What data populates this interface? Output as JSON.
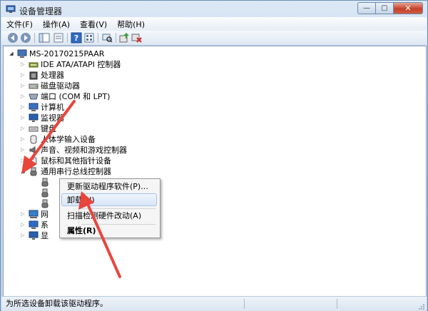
{
  "window": {
    "title": "设备管理器",
    "buttons": {
      "minimize": "—",
      "maximize": "▢",
      "close": "✕"
    }
  },
  "menubar": [
    {
      "label": "文件(F)"
    },
    {
      "label": "操作(A)"
    },
    {
      "label": "查看(V)"
    },
    {
      "label": "帮助(H)"
    }
  ],
  "toolbar": [
    {
      "icon": "back-arrow-icon"
    },
    {
      "icon": "forward-arrow-icon"
    },
    {
      "icon": "show-hide-tree-icon"
    },
    {
      "icon": "properties-icon"
    },
    {
      "icon": "help-icon"
    },
    {
      "icon": "view-list-icon"
    },
    {
      "icon": "scan-hardware-icon"
    },
    {
      "icon": "update-driver-icon"
    },
    {
      "icon": "uninstall-icon"
    }
  ],
  "tree": {
    "root": "MS-20170215PAAR",
    "categories": [
      {
        "label": "IDE ATA/ATAPI 控制器",
        "icon": "ide-controller-icon"
      },
      {
        "label": "处理器",
        "icon": "processor-icon"
      },
      {
        "label": "磁盘驱动器",
        "icon": "disk-drive-icon"
      },
      {
        "label": "端口 (COM 和 LPT)",
        "icon": "port-icon"
      },
      {
        "label": "计算机",
        "icon": "computer-icon"
      },
      {
        "label": "监视器",
        "icon": "monitor-icon"
      },
      {
        "label": "键盘",
        "icon": "keyboard-icon"
      },
      {
        "label": "人体学输入设备",
        "icon": "hid-icon"
      },
      {
        "label": "声音、视频和游戏控制器",
        "icon": "sound-icon"
      },
      {
        "label": "鼠标和其他指针设备",
        "icon": "mouse-icon"
      },
      {
        "label": "通用串行总线控制器",
        "icon": "usb-icon"
      },
      {
        "label": "网",
        "icon": "network-icon"
      },
      {
        "label": "系",
        "icon": "system-icon"
      },
      {
        "label": "显",
        "icon": "display-icon"
      }
    ],
    "usb_children_count_visible": 3
  },
  "context_menu": {
    "items": [
      {
        "label": "更新驱动程序软件(P)..."
      },
      {
        "label": "卸载(U)"
      },
      {
        "label": "扫描检测硬件改动(A)"
      },
      {
        "label": "属性(R)"
      }
    ]
  },
  "statusbar": {
    "text": "为所选设备卸载该驱动程序。"
  },
  "colors": {
    "annotation_arrow": "#e8453c",
    "selection_bg": "#d9e7f8",
    "frame": "#c3d5ec"
  }
}
